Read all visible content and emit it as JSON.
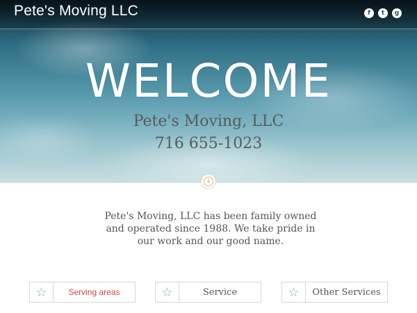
{
  "header": {
    "site_title": "Pete's Moving LLC",
    "social_icons": [
      "facebook-icon",
      "twitter-icon",
      "google-plus-icon"
    ]
  },
  "hero": {
    "welcome": "WELCOME",
    "company_name": "Pete's Moving, LLC",
    "phone": "716 655-1023",
    "scroll_icon": "arrow-down-circle-icon"
  },
  "intro": {
    "text": "Pete's Moving, LLC has been family owned and operated since 1988. We take pride in our work and our good name."
  },
  "cards": [
    {
      "label": "Serving areas",
      "icon": "star-outline-icon",
      "color": "#d9443a"
    },
    {
      "label": "Service",
      "icon": "star-outline-icon"
    },
    {
      "label": "Other Services",
      "icon": "star-outline-icon"
    }
  ],
  "colors": {
    "accent_red": "#d9443a",
    "star_teal": "#7fb7b1",
    "text_gray": "#555555"
  }
}
